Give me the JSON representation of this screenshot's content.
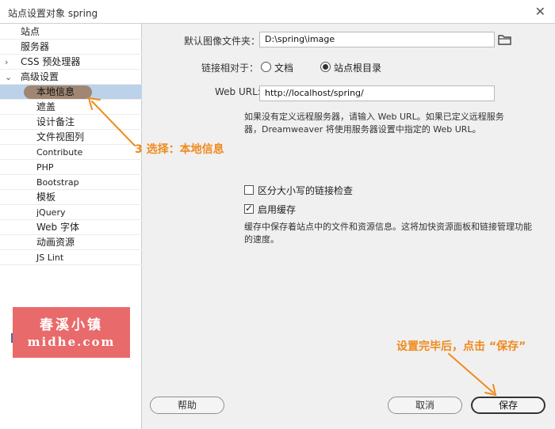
{
  "window": {
    "title": "站点设置对象 spring",
    "close_glyph": "✕"
  },
  "sidebar": {
    "items": [
      {
        "label": "站点",
        "arrow": ""
      },
      {
        "label": "服务器",
        "arrow": ""
      },
      {
        "label": "CSS 预处理器",
        "arrow": "›"
      },
      {
        "label": "高级设置",
        "arrow": "⌄"
      },
      {
        "label": "本地信息",
        "arrow": ""
      },
      {
        "label": "遮盖",
        "arrow": ""
      },
      {
        "label": "设计备注",
        "arrow": ""
      },
      {
        "label": "文件视图列",
        "arrow": ""
      },
      {
        "label": "Contribute",
        "arrow": ""
      },
      {
        "label": "PHP",
        "arrow": ""
      },
      {
        "label": "Bootstrap",
        "arrow": ""
      },
      {
        "label": "模板",
        "arrow": ""
      },
      {
        "label": "jQuery",
        "arrow": ""
      },
      {
        "label": "Web 字体",
        "arrow": ""
      },
      {
        "label": "动画资源",
        "arrow": ""
      },
      {
        "label": "JS Lint",
        "arrow": ""
      }
    ],
    "selected_label": "本地信息"
  },
  "form": {
    "default_images_label": "默认图像文件夹：",
    "default_images_value": "D:\\spring\\image",
    "links_relative_label": "链接相对于：",
    "radio_document": "文档",
    "radio_site_root": "站点根目录",
    "web_url_label": "Web URL:",
    "web_url_value": "http://localhost/spring/",
    "web_url_note": "如果没有定义远程服务器，请输入 Web URL。如果已定义远程服务器，Dreamweaver 将使用服务器设置中指定的 Web URL。",
    "case_sensitive_label": "区分大小写的链接检查",
    "enable_cache_label": "启用缓存",
    "cache_note": "缓存中保存着站点中的文件和资源信息。这将加快资源面板和链接管理功能的速度。"
  },
  "buttons": {
    "help": "帮助",
    "cancel": "取消",
    "save": "保存"
  },
  "annotations": {
    "step3": "3 选择：本地信息",
    "save_hint": "设置完毕后，点击 “保存”"
  },
  "watermark": {
    "line1": "春溪小镇",
    "line2": "midhe.com"
  },
  "colors": {
    "annotation": "#f08a1c",
    "selection": "#bcd2ea",
    "watermark_bg": "#e96a6a"
  }
}
